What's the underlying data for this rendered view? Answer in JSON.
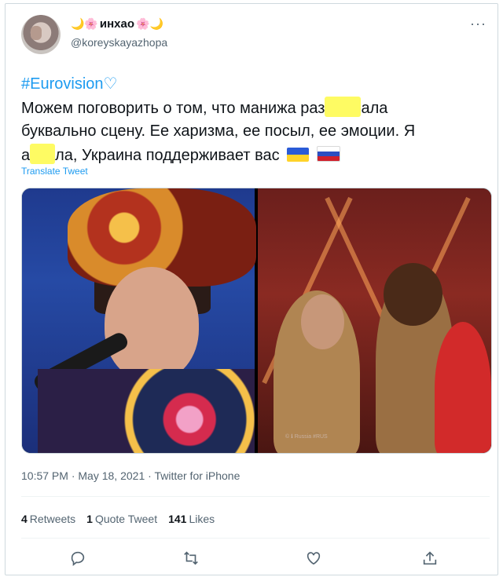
{
  "user": {
    "display_name": "инхао",
    "name_emoji_left": "🌙🌸",
    "name_emoji_right": "🌸🌙",
    "handle": "@koreyskayazhopa",
    "more_icon": "more-horizontal-icon"
  },
  "tweet": {
    "hashtag": "#Eurovision",
    "hashtag_emoji": "♡",
    "line1_a": "Можем поговорить о том, что манижа раз",
    "line1_b": "ала",
    "line2": "буквально сцену. Ее харизма, ее посыл, ее эмоции. Я",
    "line3_a": "а",
    "line3_b": "ла, Украина поддерживает вас",
    "flags": [
      "ukraine-flag",
      "russia-flag"
    ],
    "translate_label": "Translate Tweet"
  },
  "media": {
    "watermark": "© ℹ Russia #RUS"
  },
  "meta": {
    "time": "10:57 PM",
    "date": "May 18, 2021",
    "source": "Twitter for iPhone",
    "separator": " · "
  },
  "stats": {
    "retweets_count": "4",
    "retweets_label": "Retweets",
    "quotes_count": "1",
    "quotes_label": "Quote Tweet",
    "likes_count": "141",
    "likes_label": "Likes"
  },
  "colors": {
    "accent": "#1d9bf0",
    "redaction": "#fefb63",
    "muted": "#536471"
  }
}
